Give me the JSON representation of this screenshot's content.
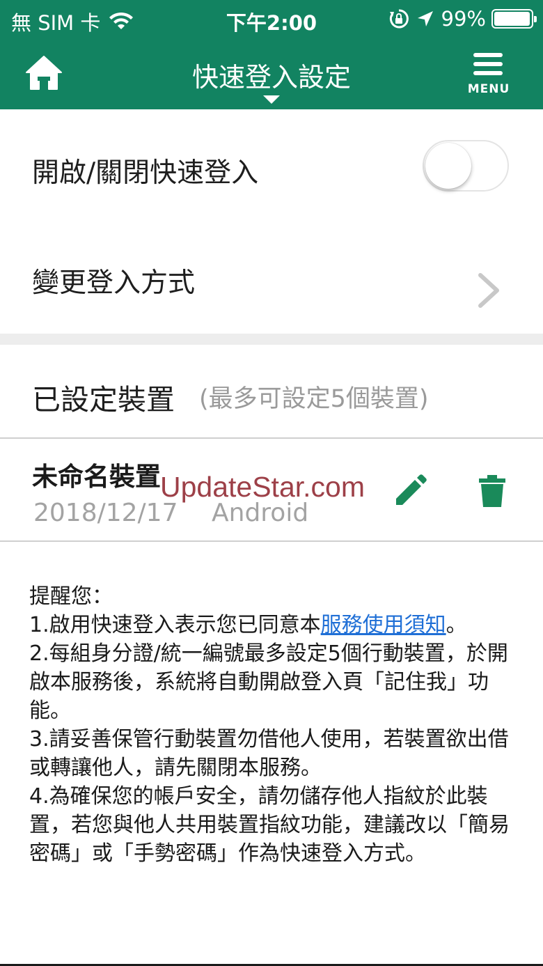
{
  "status_bar": {
    "carrier": "無 SIM 卡",
    "time": "下午2:00",
    "battery_percent": "99%",
    "battery_level": 0.99,
    "icons": [
      "wifi-icon",
      "rotation-lock-icon",
      "location-icon",
      "battery-icon"
    ]
  },
  "header": {
    "title": "快速登入設定",
    "menu_label": "MENU",
    "background_color": "#128361",
    "icons": [
      "home-icon",
      "menu-icon",
      "caret-down-icon"
    ]
  },
  "settings": {
    "toggle_label": "開啟/關閉快速登入",
    "toggle_on": false,
    "change_method_label": "變更登入方式"
  },
  "devices": {
    "section_title": "已設定裝置",
    "section_note": "(最多可設定5個裝置)",
    "items": [
      {
        "name": "未命名裝置",
        "date": "2018/12/17",
        "os": "Android"
      }
    ],
    "action_icons": [
      "pencil-icon",
      "trash-icon"
    ]
  },
  "watermark": "UpdateStar.com",
  "notes": {
    "heading": "提醒您：",
    "item1_prefix": "1.啟用快速登入表示您已同意本",
    "item1_link": "服務使用須知",
    "item1_suffix": "。",
    "item2": "2.每組身分證/統一編號最多設定5個行動裝置，於開啟本服務後，系統將自動開啟登入頁「記住我」功能。",
    "item3": "3.請妥善保管行動裝置勿借他人使用，若裝置欲出借或轉讓他人，請先關閉本服務。",
    "item4": "4.為確保您的帳戶安全，請勿儲存他人指紋於此裝置，若您與他人共用裝置指紋功能，建議改以「簡易密碼」或「手勢密碼」作為快速登入方式。",
    "link_color": "#1f6fd6"
  }
}
